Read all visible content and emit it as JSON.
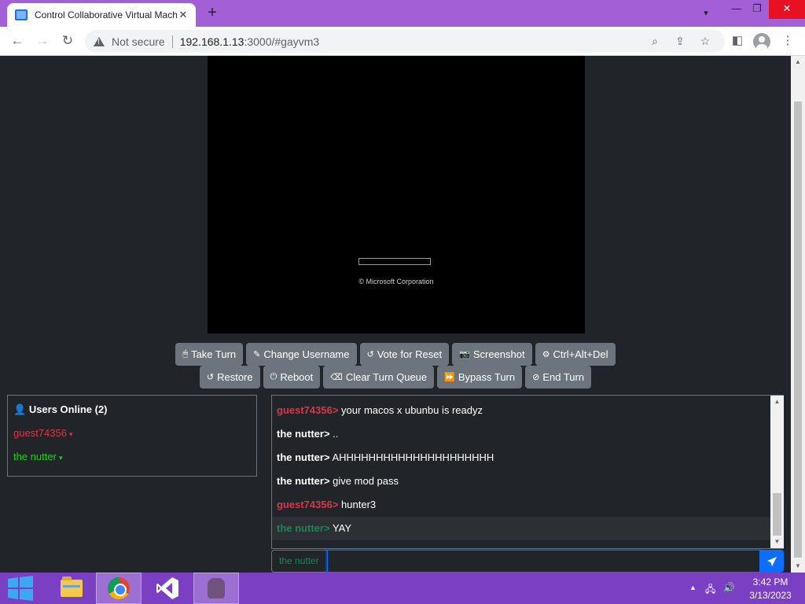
{
  "browser": {
    "tab_title": "Control Collaborative Virtual Machine",
    "new_tab_label": "+",
    "address": {
      "security_label": "Not secure",
      "url_host": "192.168.1.13",
      "url_rest": ":3000/#gayvm3"
    }
  },
  "vm_screen": {
    "copyright_text": "© Microsoft Corporation"
  },
  "controls": {
    "row1": [
      {
        "icon": "mouse-icon",
        "glyph": "🖱",
        "label": "Take Turn"
      },
      {
        "icon": "user-edit-icon",
        "glyph": "✎",
        "label": "Change Username"
      },
      {
        "icon": "rotate-icon",
        "glyph": "↺",
        "label": "Vote for Reset"
      },
      {
        "icon": "camera-icon",
        "glyph": "📷",
        "label": "Screenshot"
      },
      {
        "icon": "gear-icon",
        "glyph": "⚙",
        "label": "Ctrl+Alt+Del"
      }
    ],
    "row2": [
      {
        "icon": "undo-icon",
        "glyph": "↺",
        "label": "Restore"
      },
      {
        "icon": "power-icon",
        "glyph": "⏻",
        "label": "Reboot"
      },
      {
        "icon": "eraser-icon",
        "glyph": "⌫",
        "label": "Clear Turn Queue"
      },
      {
        "icon": "forward-icon",
        "glyph": "⏩",
        "label": "Bypass Turn"
      },
      {
        "icon": "ban-icon",
        "glyph": "⊘",
        "label": "End Turn"
      }
    ]
  },
  "users": {
    "heading": "Users Online (2)",
    "list": [
      {
        "name": "guest74356",
        "color": "#dc3545"
      },
      {
        "name": "the nutter",
        "color": "#19d319"
      }
    ]
  },
  "chat": {
    "messages": [
      {
        "user": "guest74356>",
        "text": "your macos x ubunbu is readyz",
        "user_color": "#dc3545"
      },
      {
        "user": "the nutter>",
        "text": "..",
        "user_color": "#ffffff"
      },
      {
        "user": "the nutter>",
        "text": "AHHHHHHHHHHHHHHHHHHHHH",
        "user_color": "#ffffff"
      },
      {
        "user": "the nutter>",
        "text": "give mod pass",
        "user_color": "#ffffff"
      },
      {
        "user": "guest74356>",
        "text": "hunter3",
        "user_color": "#dc3545"
      },
      {
        "user": "the nutter>",
        "text": "YAY",
        "user_color": "#198754"
      }
    ],
    "input_username": "the nutter",
    "input_value": ""
  },
  "taskbar": {
    "time": "3:42 PM",
    "date": "3/13/2023"
  },
  "colors": {
    "page_bg": "#212529",
    "button_bg": "#6c757d",
    "accent_blue": "#0d6efd",
    "taskbar_bg": "#7b3fc4",
    "tabstrip_bg": "#a35fd6"
  }
}
